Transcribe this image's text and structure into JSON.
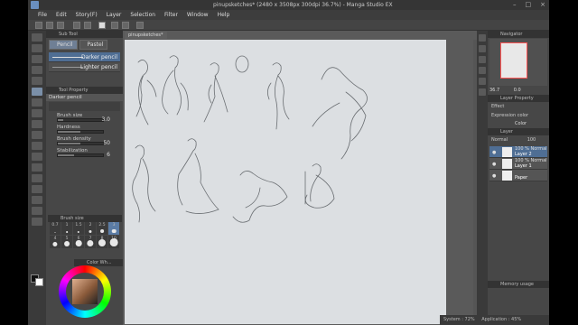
{
  "window": {
    "title": "pinupsketches* (2480 x 3508px 300dpi 36.7%) - Manga Studio EX"
  },
  "menu": [
    "File",
    "Edit",
    "Story(F)",
    "Layer",
    "Selection",
    "Filter",
    "Window",
    "Help"
  ],
  "sub_tool": {
    "header": "Sub Tool",
    "tabs": [
      "Pencil",
      "Pastel"
    ],
    "brushes": [
      "Darker pencil",
      "Lighter pencil"
    ]
  },
  "tool_property": {
    "header": "Tool Property",
    "preset_name": "Darker pencil",
    "properties": [
      {
        "label": "Brush size",
        "value": "3.0",
        "fraction": 0.12
      },
      {
        "label": "Hardness",
        "value": "",
        "fraction": 0.5
      },
      {
        "label": "Brush density",
        "value": "50",
        "fraction": 0.5
      },
      {
        "label": "Stabilization",
        "value": "6",
        "fraction": 0.35
      }
    ]
  },
  "brush_size": {
    "header": "Brush size",
    "sizes": [
      "0.7",
      "1",
      "1.5",
      "2",
      "2.5",
      "3",
      "4",
      "5",
      "6",
      "7",
      "8",
      "10"
    ],
    "selected": "3"
  },
  "color_wheel": {
    "header": "Color Wh..."
  },
  "document": {
    "tab": "pinupsketches*"
  },
  "navigator": {
    "header": "Navigator",
    "zoom": "36.7",
    "rotation": "0.0"
  },
  "layer_property": {
    "header": "Layer Property",
    "effect_label": "Effect",
    "expression_label": "Expression color",
    "expression_value": "Color"
  },
  "layer_panel": {
    "header": "Layer",
    "blend_mode": "Normal",
    "opacity": "100",
    "layers": [
      {
        "mode": "100 % Normal",
        "name": "Layer 2",
        "selected": true
      },
      {
        "mode": "100 % Normal",
        "name": "Layer 1",
        "selected": false
      },
      {
        "mode": "",
        "name": "Paper",
        "selected": false
      }
    ]
  },
  "memory": {
    "header": "Memory usage",
    "system": "System : 72%",
    "application": "Application : 45%"
  },
  "colors": {
    "accent": "#4f6e94",
    "panel": "#474747",
    "canvas": "#dcdfe2"
  }
}
